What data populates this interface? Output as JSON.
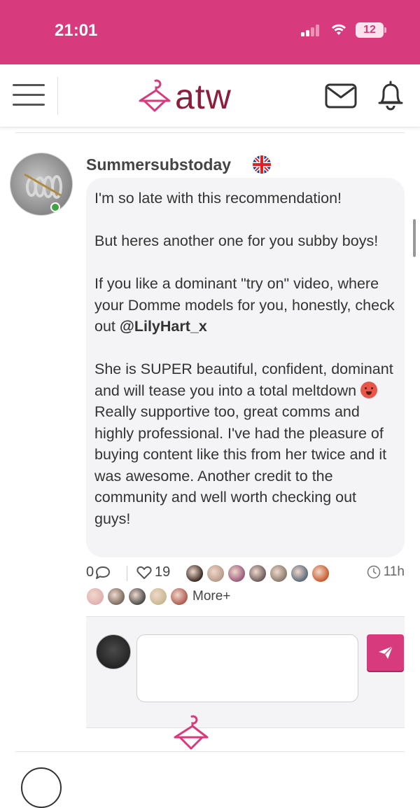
{
  "status_bar": {
    "time": "21:01",
    "battery": "12",
    "bg_color": "#d83b7d"
  },
  "header": {
    "logo_text": "atw",
    "menu_icon": "hamburger-icon",
    "mail_icon": "mail-icon",
    "notifications_icon": "bell-icon"
  },
  "post": {
    "username": "Summersubstoday",
    "country_flag": "uk-flag-icon",
    "online": true,
    "body": {
      "p1": "I'm so late with this recommendation!",
      "p2": "But heres another one for you subby boys!",
      "p3_prefix": "If you like a dominant \"try on\" video, where your Domme models for you, honestly, check out ",
      "p3_mention": "@LilyHart_x",
      "p4_prefix": "She is SUPER beautiful, confident, dominant and will tease you into a total meltdown ",
      "p4_emoji": "hot-face-emoji",
      "p4_suffix": " Really supportive too, great comms and highly professional. I've had the pleasure of buying content like this from her twice and it was awesome. Another credit to the community and well worth checking out guys!"
    },
    "comment_count": "0",
    "like_count": "19",
    "time_ago": "11h",
    "more_label": "More+",
    "likers_row1_colors": [
      "#3a2a22",
      "#b89a88",
      "#9a5a7a",
      "#6a5a5a",
      "#8a7a6a",
      "#5a6a7a",
      "#c85a2a"
    ],
    "likers_row2_colors": [
      "#e0b0b0",
      "#7a6a60",
      "#4a4a4a",
      "#c8b890",
      "#b05a50"
    ]
  },
  "comment_box": {
    "value": "",
    "send_icon": "paper-plane-icon"
  },
  "colors": {
    "accent": "#d83b7d",
    "logo": "#8b1d3d",
    "bubble": "#f4f4f6"
  }
}
